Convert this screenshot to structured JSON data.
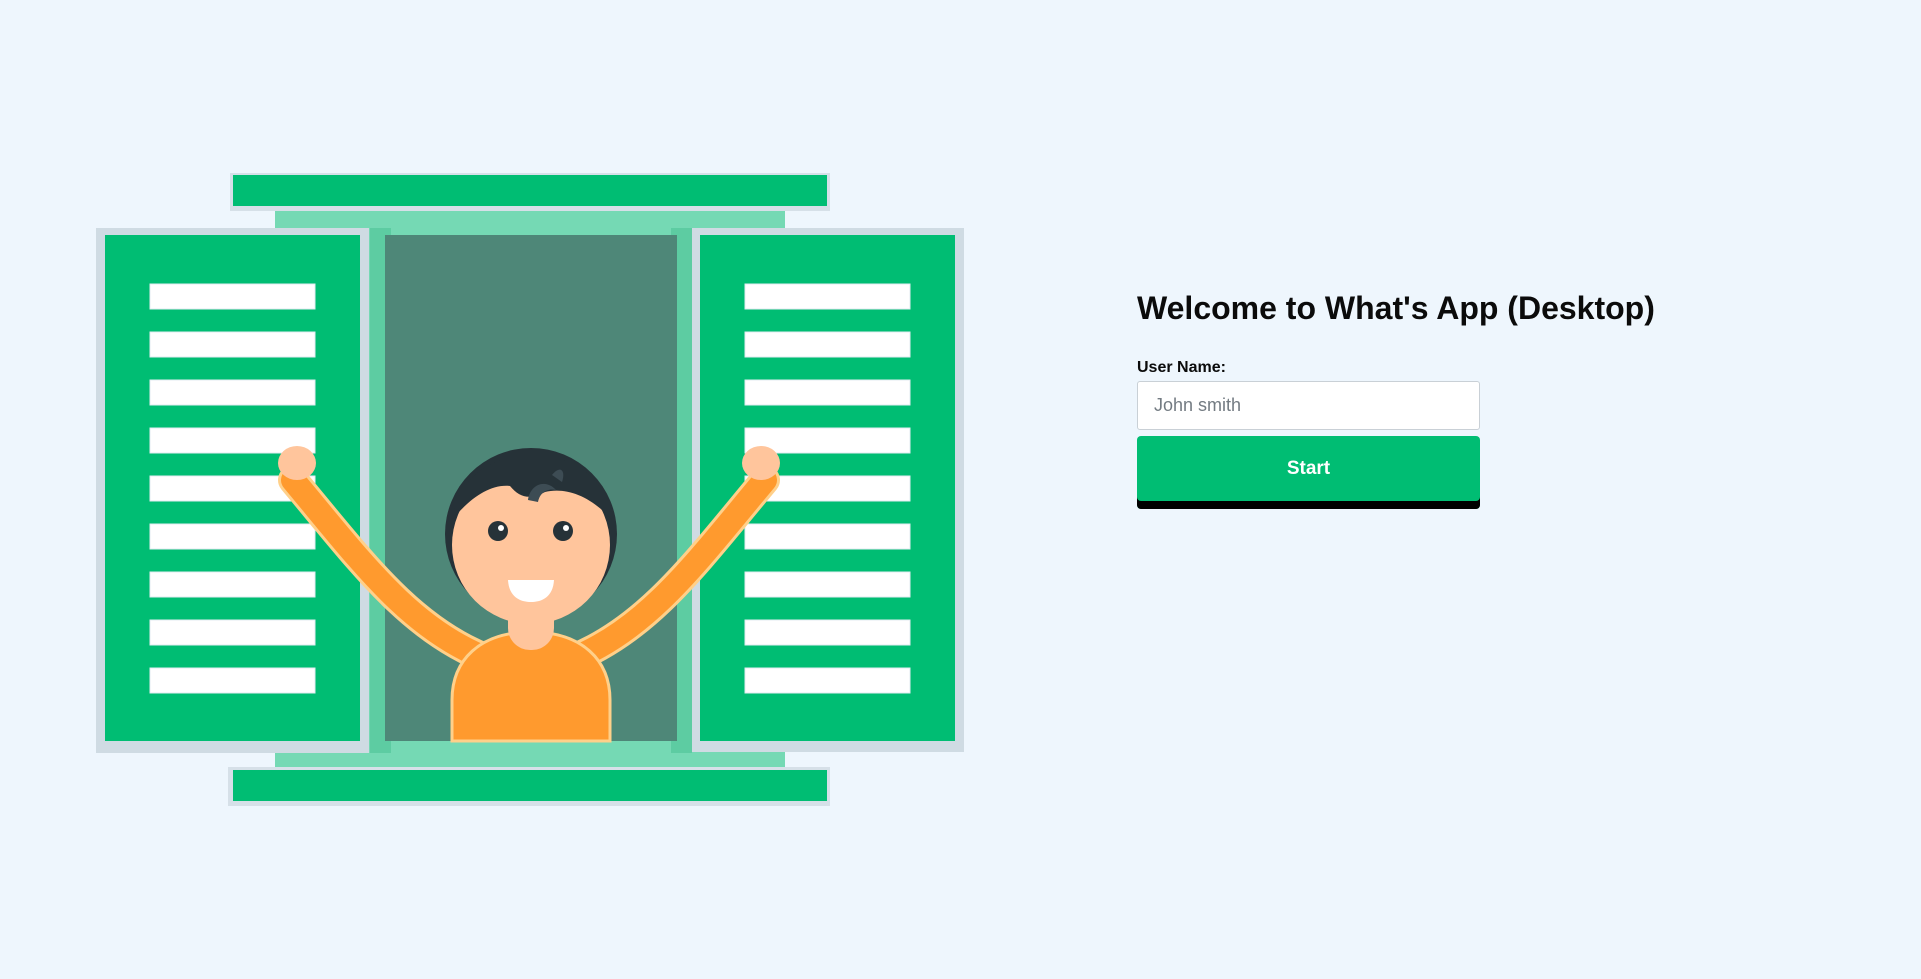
{
  "welcome": {
    "title": "Welcome to What's App (Desktop)"
  },
  "form": {
    "username_label": "User Name:",
    "username_placeholder": "John smith",
    "username_value": "",
    "start_label": "Start"
  },
  "colors": {
    "background": "#eef6fd",
    "brand_green": "#00bd73",
    "frame_light_green": "#75d9b4",
    "window_interior": "#4e8778",
    "shirt_orange": "#ff9a2e",
    "skin": "#ffc59c",
    "hair": "#263238"
  },
  "illustration": {
    "subject": "person-waving-from-window"
  }
}
